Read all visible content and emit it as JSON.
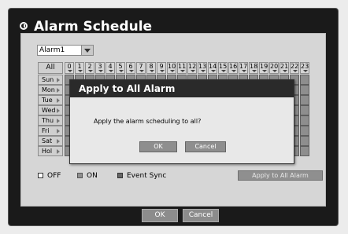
{
  "window": {
    "title": "Alarm Schedule"
  },
  "alarm_select": {
    "value": "Alarm1"
  },
  "grid": {
    "all_label": "All",
    "hours": [
      "0",
      "1",
      "2",
      "3",
      "4",
      "5",
      "6",
      "7",
      "8",
      "9",
      "10",
      "11",
      "12",
      "13",
      "14",
      "15",
      "16",
      "17",
      "18",
      "19",
      "20",
      "21",
      "22",
      "23"
    ],
    "days": [
      "Sun",
      "Mon",
      "Tue",
      "Wed",
      "Thu",
      "Fri",
      "Sat",
      "Hol"
    ]
  },
  "legend": {
    "off": "OFF",
    "on": "ON",
    "event_sync": "Event Sync"
  },
  "apply_all_label": "Apply to All Alarm",
  "footer": {
    "ok": "OK",
    "cancel": "Cancel"
  },
  "dialog": {
    "title": "Apply to All Alarm",
    "message": "Apply the alarm scheduling to all?",
    "ok": "OK",
    "cancel": "Cancel"
  },
  "colors": {
    "cell_on": "#8e8e8e",
    "cell_border": "#5e5e5e",
    "legend_off": "#ffffff",
    "legend_on": "#8e8e8e",
    "legend_event_sync": "#666666"
  }
}
